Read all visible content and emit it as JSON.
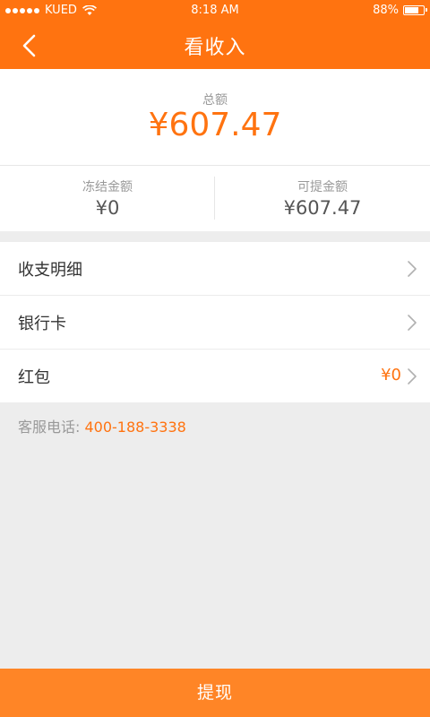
{
  "status_bar": {
    "carrier": "KUED",
    "time": "8:18 AM",
    "battery": "88%",
    "signal_icon": "signal-dots-icon",
    "wifi_icon": "wifi-icon",
    "battery_icon": "battery-icon"
  },
  "nav": {
    "title": "看收入",
    "back_icon": "chevron-left-icon"
  },
  "summary": {
    "total_label": "总额",
    "total_amount": "¥607.47",
    "frozen_label": "冻结金额",
    "frozen_amount": "¥0",
    "available_label": "可提金额",
    "available_amount": "¥607.47"
  },
  "menu": {
    "items": [
      {
        "label": "收支明细",
        "value": "",
        "icon": "chevron-right-icon"
      },
      {
        "label": "银行卡",
        "value": "",
        "icon": "chevron-right-icon"
      },
      {
        "label": "红包",
        "value": "¥0",
        "icon": "chevron-right-icon"
      }
    ]
  },
  "service": {
    "label": "客服电话: ",
    "phone": "400-188-3338"
  },
  "footer": {
    "withdraw_label": "提现"
  },
  "colors": {
    "accent": "#ff7310",
    "button": "#ff8526",
    "background": "#ededed"
  }
}
